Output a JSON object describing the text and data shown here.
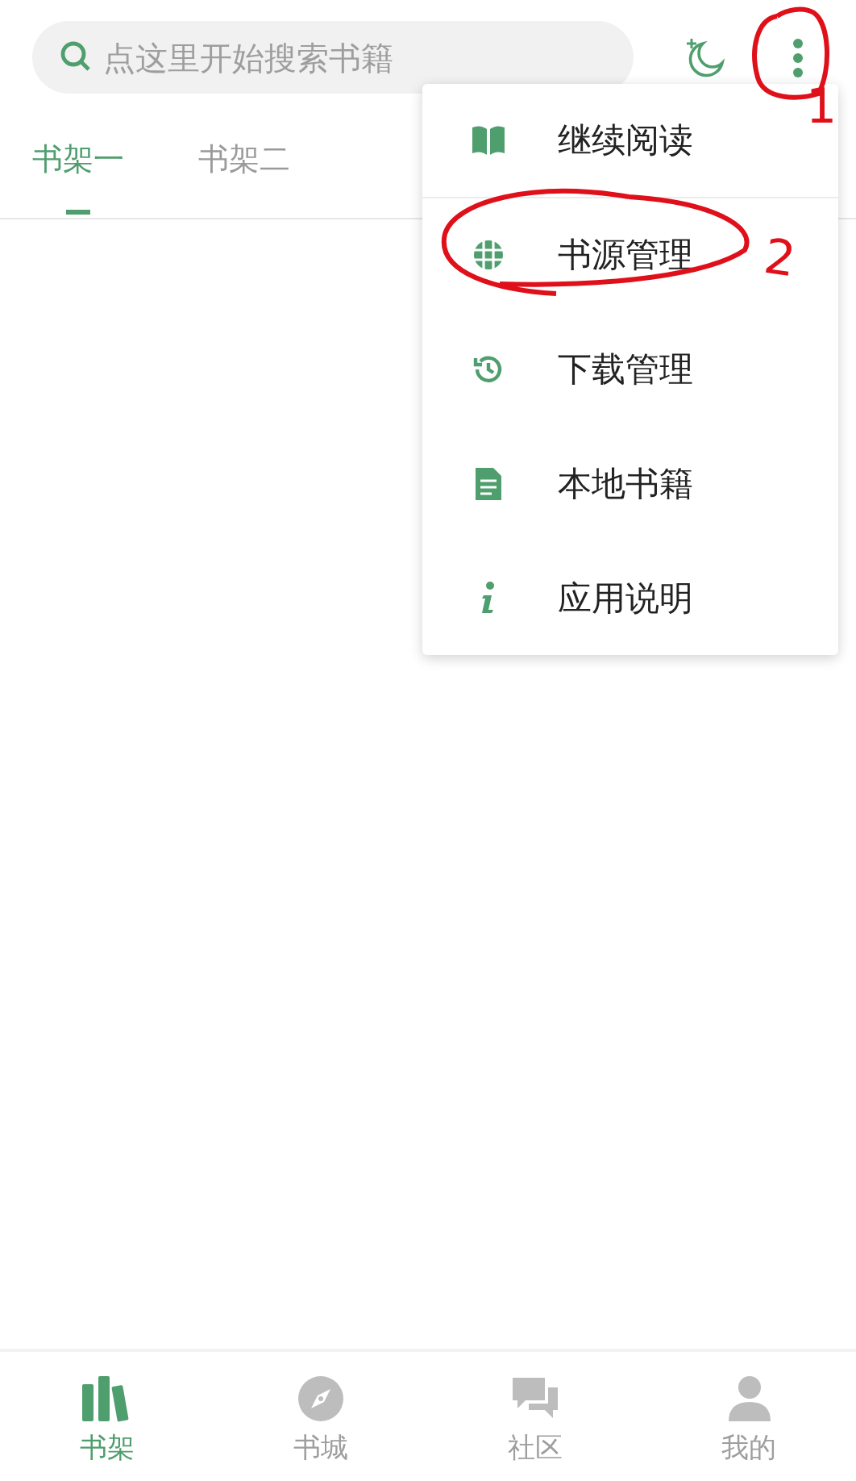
{
  "search": {
    "placeholder": "点这里开始搜索书籍"
  },
  "tabs": [
    {
      "label": "书架一",
      "selected": true
    },
    {
      "label": "书架二",
      "selected": false
    }
  ],
  "menu": {
    "items": [
      {
        "label": "继续阅读"
      },
      {
        "label": "书源管理"
      },
      {
        "label": "下载管理"
      },
      {
        "label": "本地书籍"
      },
      {
        "label": "应用说明"
      }
    ]
  },
  "bottom_nav": [
    {
      "label": "书架",
      "selected": true
    },
    {
      "label": "书城",
      "selected": false
    },
    {
      "label": "社区",
      "selected": false
    },
    {
      "label": "我的",
      "selected": false
    }
  ],
  "annotations": [
    {
      "label": "1"
    },
    {
      "label": "2"
    }
  ]
}
